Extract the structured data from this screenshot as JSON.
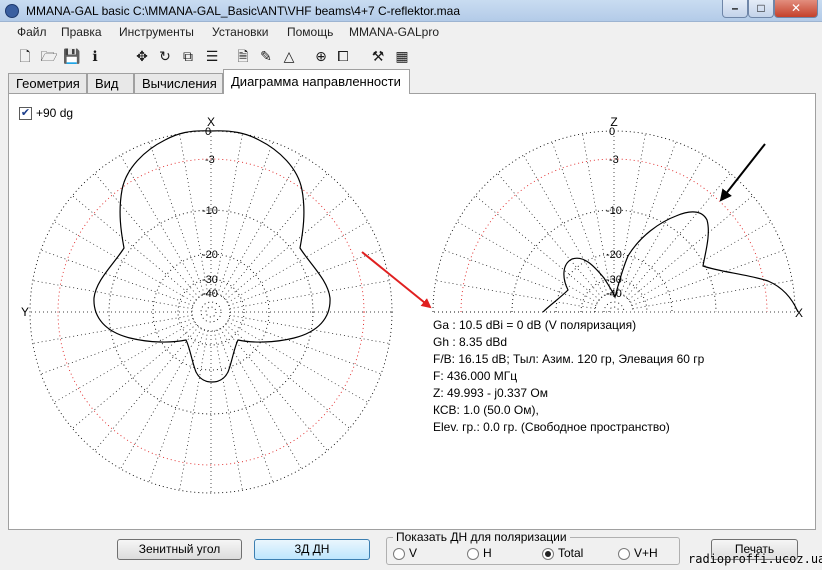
{
  "window": {
    "title": "MMANA-GAL basic C:\\MMANA-GAL_Basic\\ANT\\VHF beams\\4+7  C-reflektor.maa",
    "minimize": "–",
    "maximize": "□",
    "close": "✕"
  },
  "menu": [
    "Файл",
    "Правка",
    "Инструменты",
    "Установки",
    "Помощь",
    "MMANA-GALpro"
  ],
  "toolbar_icons": [
    "new-file-icon",
    "open-folder-icon",
    "save-icon",
    "info-icon",
    "move-icon",
    "rotate-icon",
    "copy-icon",
    "wire-edit-icon",
    "page-icon",
    "brush-icon",
    "triangle-icon",
    "crosshair-icon",
    "duplicate-icon",
    "tools-icon",
    "calculator-icon"
  ],
  "tabs": [
    "Геометрия",
    "Вид",
    "Вычисления",
    "Диаграмма направленности"
  ],
  "active_tab": 3,
  "options": {
    "plus90_label": "+90 dg",
    "plus90_checked": true
  },
  "horizontal_pattern": {
    "axis_top": "X",
    "axis_left": "Y",
    "ring_labels": [
      "0",
      "-3",
      "-10",
      "-20",
      "-30",
      "-40"
    ]
  },
  "vertical_pattern": {
    "axis_top": "Z",
    "axis_right": "X",
    "ring_labels": [
      "0",
      "-3",
      "-10",
      "-20",
      "-30",
      "-40"
    ]
  },
  "results": [
    "Ga : 10.5 dBi = 0 dB  (V поляризация)",
    "Gh : 8.35 dBd",
    "F/B: 16.15 dB; Тыл: Азим. 120 гр, Элевация 60 гр",
    "F: 436.000 МГц",
    "Z: 49.993 - j0.337 Ом",
    "КСВ: 1.0 (50.0 Ом),",
    "Elev. гр.: 0.0 гр. (Свободное пространство)"
  ],
  "buttons": {
    "zenith": "Зенитный угол",
    "view3d": "3Д   ДН",
    "print": "Печать"
  },
  "polarization": {
    "label": "Показать ДН для поляризации",
    "options": [
      "V",
      "H",
      "Total",
      "V+H"
    ],
    "selected": "Total"
  },
  "watermark": "radioproffi.ucoz.ua",
  "colors": {
    "annotation_arrow": "#e02020",
    "grid_dots": "#000000",
    "pattern": "#000000"
  }
}
